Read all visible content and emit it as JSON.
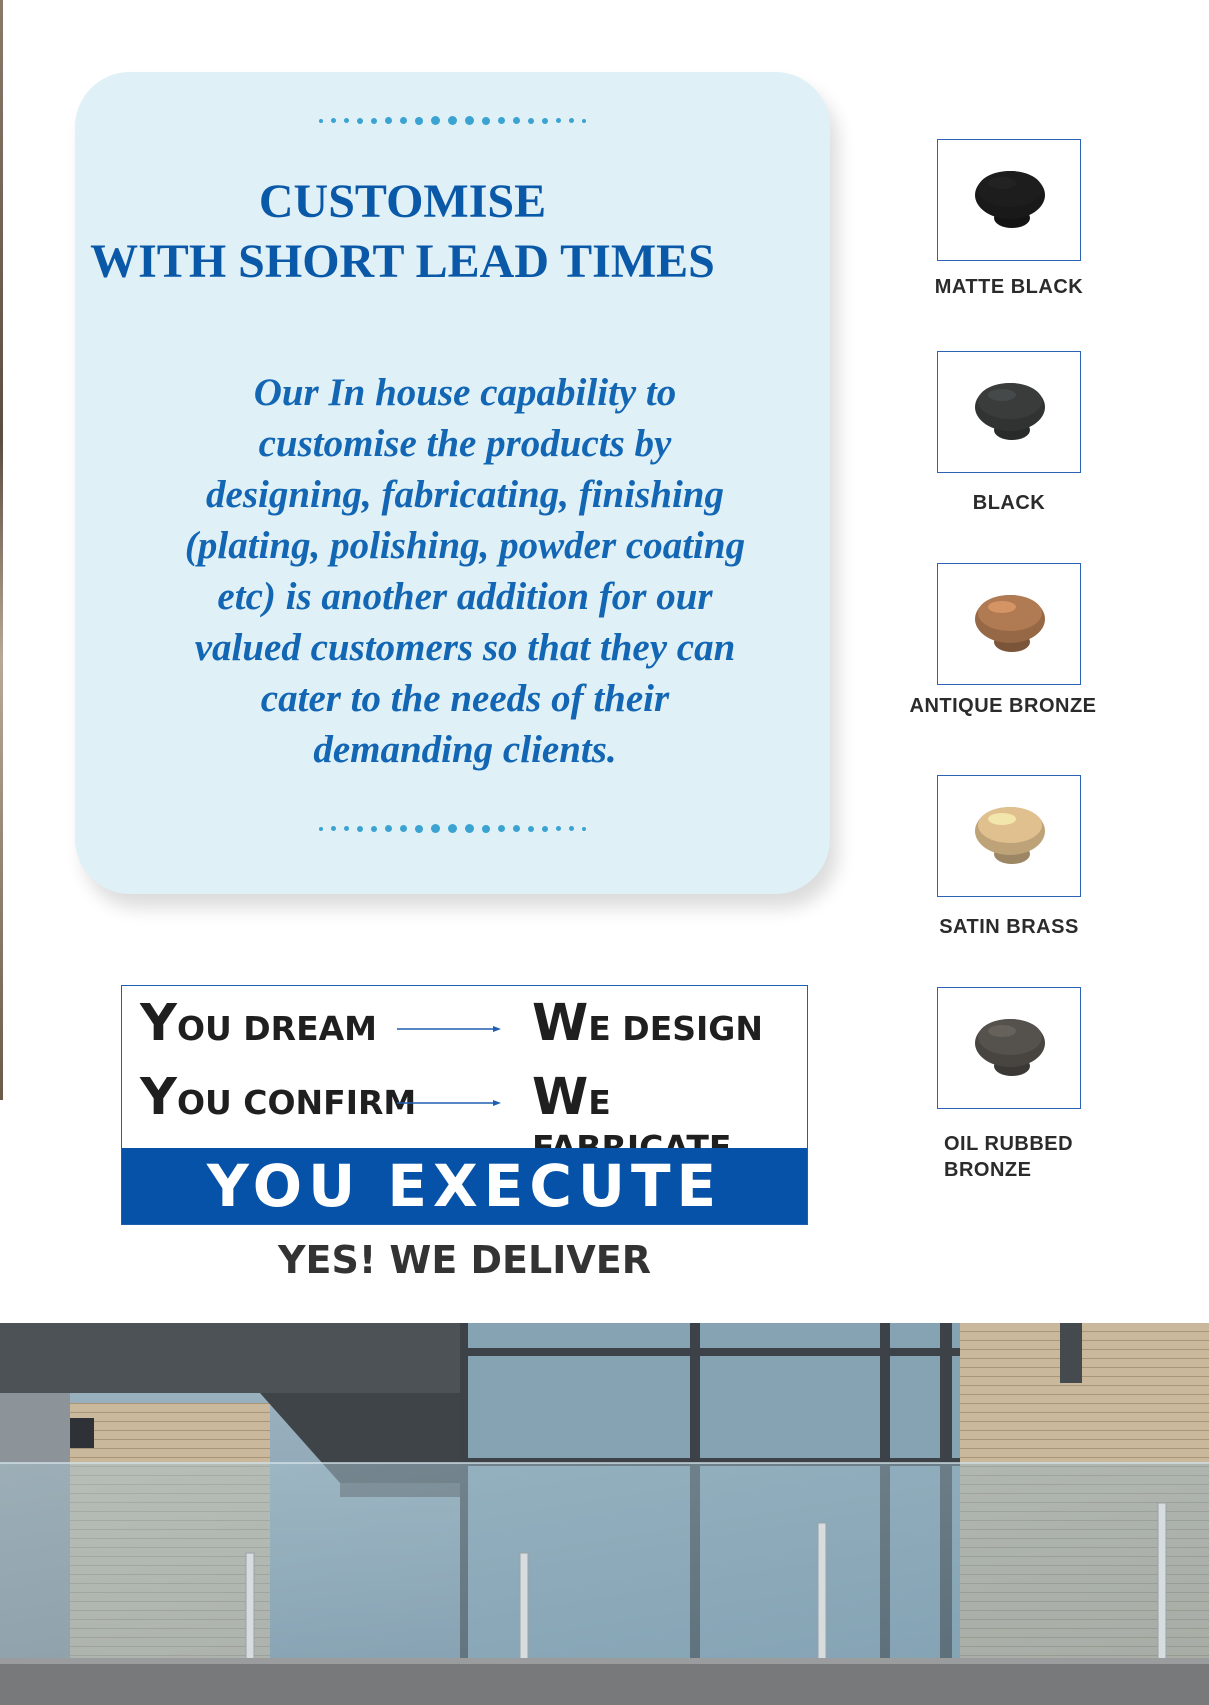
{
  "card": {
    "title_line1": "CUSTOMISE",
    "title_line2": "WITH SHORT LEAD TIMES",
    "body_lines": [
      "Our In house capability to",
      "customise the products by",
      "designing, fabricating, finishing",
      "(plating, polishing, powder coating",
      "etc) is another addition for our",
      "valued customers so that they can",
      "cater to the needs of their",
      "demanding clients."
    ],
    "accent_color": "#0a58a8",
    "background_color": "#dff0f6"
  },
  "finishes": [
    {
      "label": "MATTE BLACK",
      "icon": "knob-icon",
      "color": "#1d1d1d"
    },
    {
      "label": "BLACK",
      "icon": "knob-icon",
      "color": "#3a3c3c"
    },
    {
      "label": "ANTIQUE BRONZE",
      "icon": "knob-icon",
      "color": "#b07a52"
    },
    {
      "label": "SATIN BRASS",
      "icon": "knob-icon",
      "color": "#e0c08e"
    },
    {
      "label": "OIL RUBBED BRONZE",
      "icon": "knob-icon",
      "color": "#55514d"
    }
  ],
  "slogan": {
    "row1_left_cap": "Y",
    "row1_left_rest": "OU DREAM",
    "row1_right_cap": "W",
    "row1_right_rest": "E DESIGN",
    "row2_left_cap": "Y",
    "row2_left_rest": "OU CONFIRM",
    "row2_right_cap": "W",
    "row2_right_rest": "E FABRICATE",
    "banner": "YOU EXECUTE",
    "tagline": "YES! WE DELIVER",
    "banner_color": "#0552a8"
  },
  "photo": {
    "subject": "glass-balustrade-photo"
  }
}
